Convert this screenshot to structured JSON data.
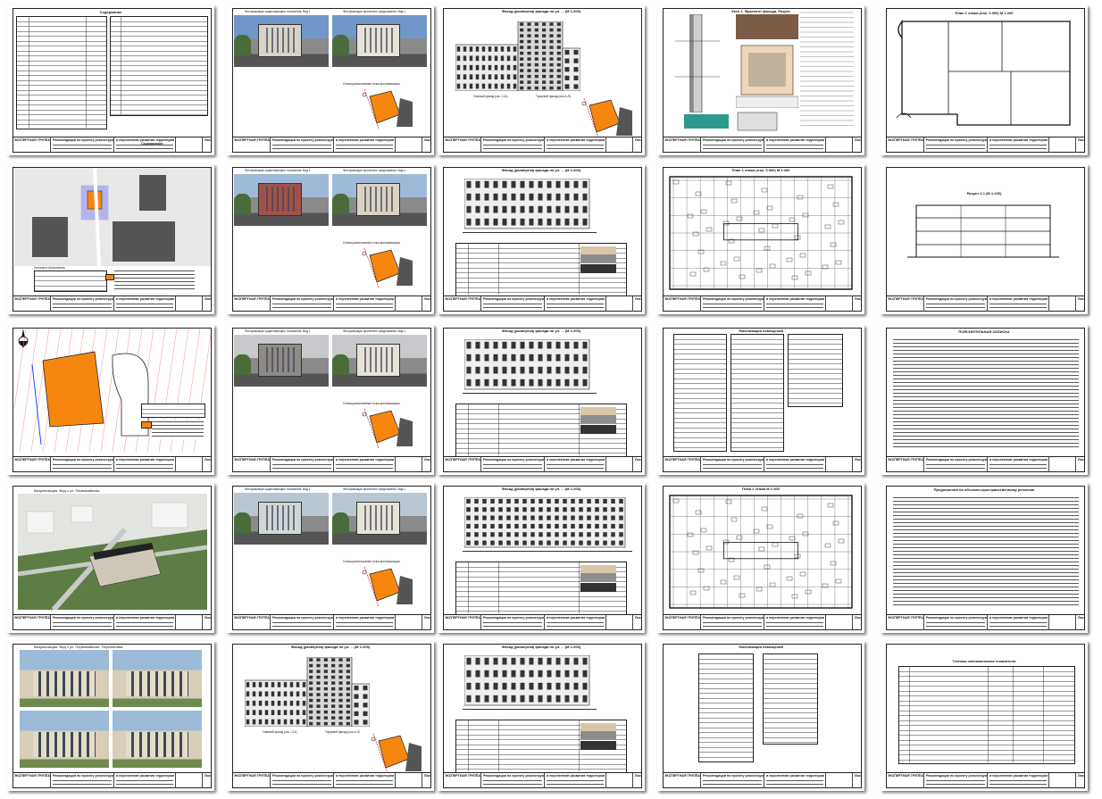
{
  "title_block": {
    "line1": "ЭКСПЕРТНАЯ ГРУППА",
    "line2": "Рекомендации по проекту реконструкции",
    "line3": "и перспективе развития территории",
    "sheet_label": "Лист"
  },
  "sheets": {
    "contents": {
      "title": "Содержание",
      "col_sheet": "Лист",
      "col_name": "Наименование",
      "col_note": "Примечание",
      "bottom": "Содержание"
    },
    "photo_fixation": {
      "caption_left": "Фотофиксация существующего положения. Вид 1",
      "caption_right": "Фотофиксация проектного предложения. Вид 1",
      "scheme": "Схема расположения точки фотофиксации"
    },
    "facade": {
      "title": "Фасад (развёртка) фасада по ул. ... (М 1:200)",
      "label_main": "Главный фасад (ось 1-14)",
      "label_side": "Торцевой фасад (ось А-Л)"
    },
    "detail": {
      "title": "Узел 1. Фрагмент фасада. Разрез"
    },
    "plan": {
      "title": "План 1 этажа (отм. 0.000) М 1:200",
      "title2": "План 2 этажа М 1:200"
    },
    "situation": {
      "title": "Ситуационный план",
      "legend": "Условные обозначения"
    },
    "section": {
      "title": "Разрез 1-1 (М 1:200)"
    },
    "explication": {
      "title": "Экспликация помещений"
    },
    "note": {
      "title": "ПОЯСНИТЕЛЬНАЯ ЗАПИСКА",
      "title2": "Предложения по объемно-пространственному решению"
    },
    "visual1": {
      "title": "Визуализация. Вид с ул. Первомайская"
    },
    "visual2": {
      "title": "Визуализация. Вид с ул. Первомайская. Перспектива"
    },
    "tep": {
      "title": "Технико-экономические показатели"
    }
  }
}
